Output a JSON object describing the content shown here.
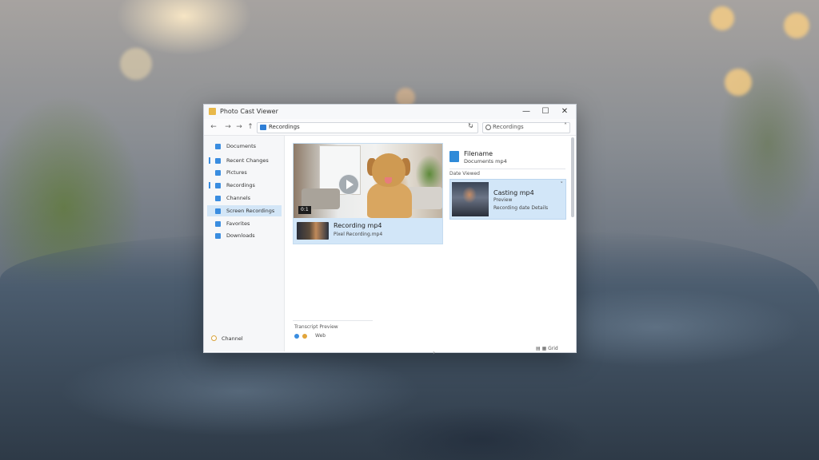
{
  "window": {
    "title": "Photo Cast Viewer",
    "controls": {
      "minimize": "—",
      "maximize": "☐",
      "close": "✕"
    }
  },
  "nav": {
    "back": "←",
    "forward": "→",
    "forward2": "→",
    "up": "↑",
    "address": "Recordings",
    "address_dropdown": "⌄",
    "refresh": "↻",
    "search_text": "Recordings",
    "search_button": "˄"
  },
  "sidebar": {
    "items": [
      {
        "label": "Documents"
      },
      {
        "label": "Recent Changes"
      },
      {
        "label": "Pictures"
      },
      {
        "label": "Recordings"
      },
      {
        "label": "Channels"
      },
      {
        "label": "Screen Recordings"
      },
      {
        "label": "Favorites"
      },
      {
        "label": "Downloads"
      }
    ],
    "bottom_label": "Channel"
  },
  "main": {
    "card1": {
      "duration": "0:1",
      "title": "Recording mp4",
      "subtitle": "Pixel Recording.mp4"
    },
    "more_chevron": "›",
    "details": {
      "title": "Filename",
      "subtitle": "Documents mp4",
      "caption": "Date Viewed",
      "card2": {
        "title": "Casting mp4",
        "sub1": "Preview",
        "sub2": "Recording date Details",
        "chevron": "˅"
      }
    },
    "status": {
      "label": "Transcript Preview",
      "text": "Web",
      "view_switch": "▤ ▦ Grid"
    }
  },
  "colors": {
    "accent": "#3a8de0",
    "selection": "#d2e6f8",
    "window_bg": "#ffffff"
  },
  "icons": [
    "app-icon",
    "folder-icon",
    "search-icon",
    "play-icon",
    "file-icon",
    "gear-icon"
  ]
}
